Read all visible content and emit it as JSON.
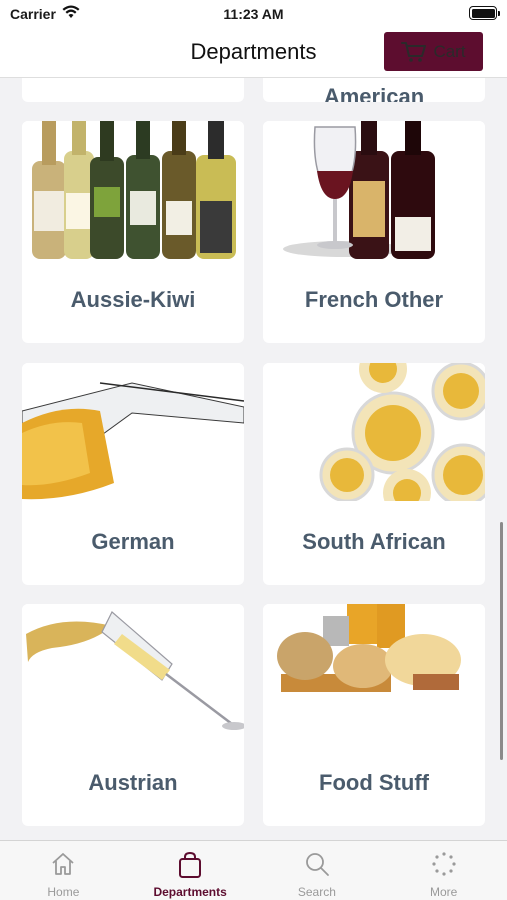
{
  "status": {
    "carrier": "Carrier",
    "time": "11:23 AM"
  },
  "nav": {
    "title": "Departments",
    "cart_label": "Cart"
  },
  "partial_card": {
    "label": "American"
  },
  "departments": [
    {
      "label": "Aussie-Kiwi",
      "image": "white-wine-bottles"
    },
    {
      "label": "French Other",
      "image": "red-wine-bottles-glass"
    },
    {
      "label": "German",
      "image": "white-wine-glass-pour"
    },
    {
      "label": "South African",
      "image": "white-wine-glasses-topview"
    },
    {
      "label": "Austrian",
      "image": "champagne-glass-splash"
    },
    {
      "label": "Food Stuff",
      "image": "pasta-groceries"
    }
  ],
  "tabs": [
    {
      "label": "Home",
      "icon": "home-icon"
    },
    {
      "label": "Departments",
      "icon": "bag-icon",
      "active": true
    },
    {
      "label": "Search",
      "icon": "search-icon"
    },
    {
      "label": "More",
      "icon": "more-icon"
    }
  ],
  "colors": {
    "brand": "#5d0d2f",
    "label": "#4a5b6c",
    "background": "#f2f2f4"
  }
}
